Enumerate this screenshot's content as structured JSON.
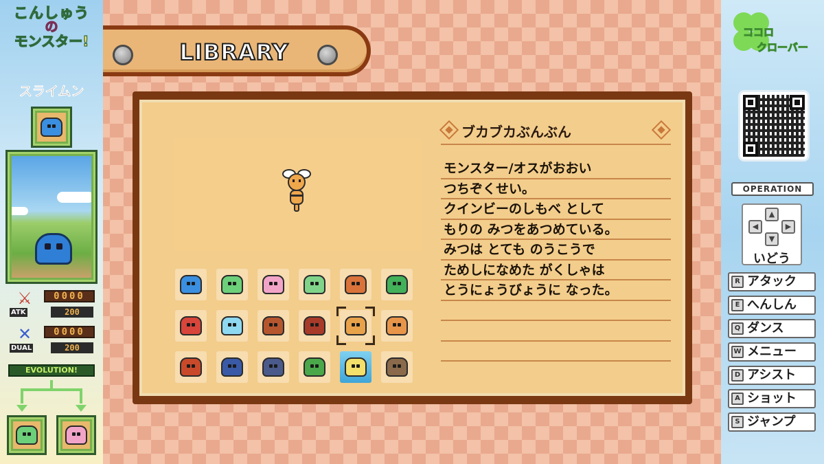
{
  "logo": {
    "line1": "こんしゅうの",
    "line2": "の",
    "line3": "モンスター!"
  },
  "monster": {
    "name": "スライムン",
    "stats": {
      "atk_label": "ATK",
      "atk_digits": "0000",
      "atk_value": "200",
      "dual_label": "DUAL",
      "dual_digits": "0000",
      "dual_value": "200"
    },
    "evolution_label": "EVOLUTION!"
  },
  "library": {
    "title": "LIBRARY"
  },
  "selected_monster": {
    "name": "ブカブカぶんぶん",
    "description": [
      "モンスター/オスがおおい",
      "つちぞくせい。",
      "クインビーのしもべ として",
      "もりの みつをあつめている。",
      "みつは とても のうこうで",
      "ためしになめた がくしゃは",
      "とうにょうびょうに なった。",
      "",
      "",
      ""
    ]
  },
  "grid": {
    "rows": 3,
    "cols": 6,
    "selected_index": 10,
    "colors": [
      "#3a8fe0",
      "#6ccf7a",
      "#f2a4c8",
      "#7fd48a",
      "#d9733a",
      "#43b05a",
      "#d8453a",
      "#8fd8f2",
      "#b5562e",
      "#a83a2a",
      "#e8a24a",
      "#e8954a",
      "#c94a2a",
      "#3a5aa8",
      "#4a5a8a",
      "#4aa84a",
      "#f2e06a",
      "#8a6a4a"
    ]
  },
  "brand": {
    "line1": "ココロ",
    "line2": "クローバー"
  },
  "operation": {
    "label": "OPERATION",
    "move_label": "いどう",
    "controls": [
      {
        "key": "R",
        "label": "アタック"
      },
      {
        "key": "E",
        "label": "へんしん"
      },
      {
        "key": "Q",
        "label": "ダンス"
      },
      {
        "key": "W",
        "label": "メニュー"
      },
      {
        "key": "D",
        "label": "アシスト"
      },
      {
        "key": "A",
        "label": "ショット"
      },
      {
        "key": "S",
        "label": "ジャンプ"
      }
    ]
  },
  "colors": {
    "panel_border": "#7a3812",
    "panel_fill": "#f3cd8c",
    "checker_light": "#f3c2a8",
    "checker_dark": "#e9a98e",
    "rule_line": "#c7864a"
  },
  "icons": {
    "sword": "sword-icon",
    "dual": "dual-swords-icon",
    "diamond": "diamond-icon",
    "screw": "screw-icon"
  }
}
